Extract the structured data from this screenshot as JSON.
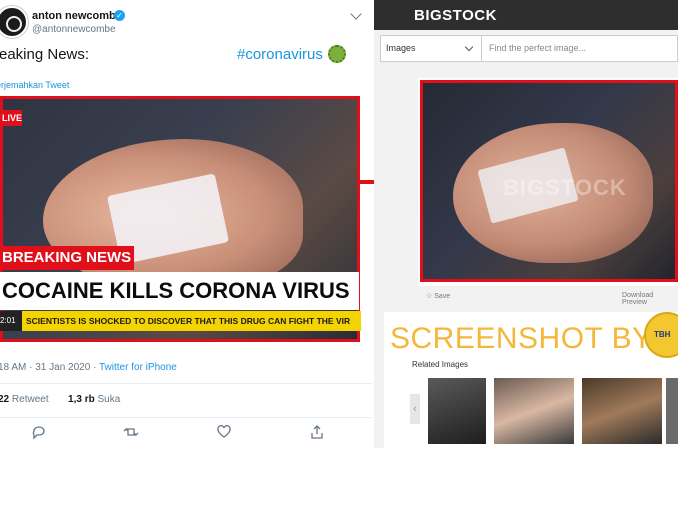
{
  "tweet": {
    "author_name": "anton newcombe",
    "handle": "@antonnewcombe",
    "text": "reaking News:",
    "hashtag": "#coronavirus",
    "translate": "erjemahkan Tweet",
    "image": {
      "live": "LIVE",
      "breaking": "BREAKING NEWS",
      "headline": "COCAINE KILLS CORONA VIRUS",
      "time": "2:01",
      "ticker": "SCIENTISTS IS SHOCKED TO DISCOVER THAT THIS DRUG CAN FIGHT THE VIR"
    },
    "meta": {
      "time_date": "18 AM · 31 Jan 2020 · ",
      "source": "Twitter for iPhone"
    },
    "stats": {
      "retweets_count": "22",
      "retweets_label": "Retweet",
      "likes_count": "1,3 rb",
      "likes_label": "Suka"
    }
  },
  "bigstock": {
    "logo": "BIGSTOCK",
    "search_category": "Images",
    "search_placeholder": "Find the perfect image...",
    "watermark": "BIGSTOCK",
    "save_label": "Save",
    "download_label": "Download Preview",
    "screenshot_label": "SCREENSHOT BY",
    "seal_text": "TURN BACK HOAX",
    "related_label": "Related Images"
  },
  "colors": {
    "highlight_red": "#e0101a",
    "twitter_blue": "#1b95e0",
    "ticker_yellow": "#f4d400",
    "screenshot_orange": "#f5b73a"
  }
}
